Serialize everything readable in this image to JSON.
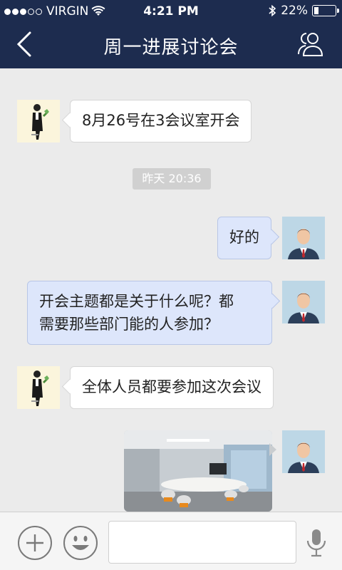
{
  "status_bar": {
    "carrier": "VIRGIN",
    "time": "4:21 PM",
    "battery": "22%",
    "battery_level": 0.22,
    "signal_dots": 3,
    "icons": [
      "signal-dots-icon",
      "wifi-icon",
      "bluetooth-icon",
      "battery-icon"
    ]
  },
  "nav": {
    "title": "周一进展讨论会",
    "back_icon": "chevron-left-icon",
    "contacts_icon": "people-icon"
  },
  "messages": [
    {
      "side": "in",
      "text": "8月26号在3会议室开会",
      "avatar": "bot-avatar"
    },
    {
      "type": "timestamp",
      "text": "昨天 20:36"
    },
    {
      "side": "out",
      "text": "好的",
      "avatar": "businessman-avatar"
    },
    {
      "side": "out",
      "text_line1": "开会主题都是关于什么呢？都",
      "text_line2": "需要那些部门能的人参加？",
      "avatar": "businessman-avatar"
    },
    {
      "side": "in",
      "text": "全体人员都要参加这次会议",
      "avatar": "bot-avatar"
    },
    {
      "side": "out",
      "type": "image",
      "image": "meeting-room-photo",
      "avatar": "businessman-avatar"
    }
  ],
  "input_bar": {
    "placeholder": "",
    "value": "",
    "icons": [
      "plus-icon",
      "emoji-icon",
      "microphone-icon"
    ]
  },
  "colors": {
    "nav_bg": "#1d2c4f",
    "chat_bg": "#ebebeb",
    "bubble_in": "#ffffff",
    "bubble_out": "#dde6fb",
    "timestamp_bg": "#d0d0d0"
  }
}
